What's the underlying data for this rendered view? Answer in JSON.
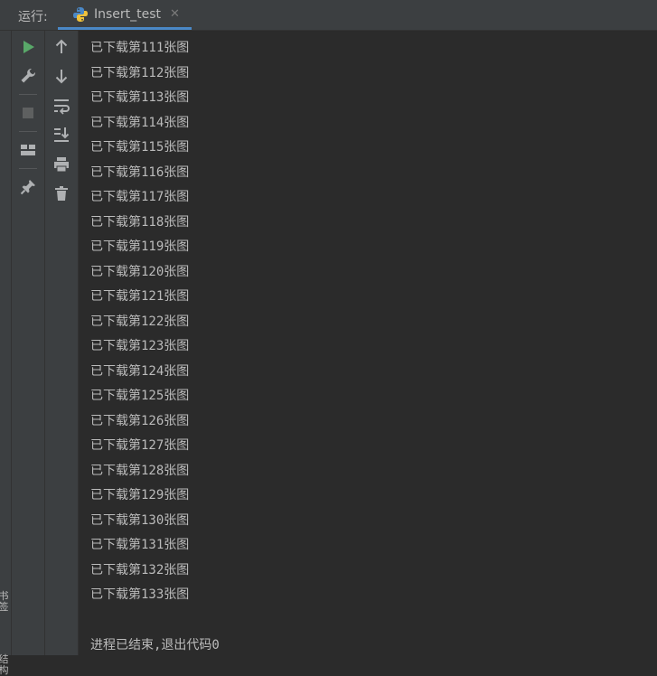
{
  "header": {
    "run_label": "运行:",
    "tab_label": "Insert_test",
    "tab_icon": "python-icon"
  },
  "left_strip": {
    "label1": "书签",
    "label2": "结构"
  },
  "toolbar1": {
    "buttons": [
      "run-icon",
      "wrench-icon",
      "stop-icon",
      "layout-icon",
      "pin-icon"
    ]
  },
  "toolbar2": {
    "buttons": [
      "up-arrow-icon",
      "down-arrow-icon",
      "soft-wrap-icon",
      "scroll-to-end-icon",
      "print-icon",
      "trash-icon"
    ]
  },
  "console": {
    "lines": [
      "已下载第111张图",
      "已下载第112张图",
      "已下载第113张图",
      "已下载第114张图",
      "已下载第115张图",
      "已下载第116张图",
      "已下载第117张图",
      "已下载第118张图",
      "已下载第119张图",
      "已下载第120张图",
      "已下载第121张图",
      "已下载第122张图",
      "已下载第123张图",
      "已下载第124张图",
      "已下载第125张图",
      "已下载第126张图",
      "已下载第127张图",
      "已下载第128张图",
      "已下载第129张图",
      "已下载第130张图",
      "已下载第131张图",
      "已下载第132张图",
      "已下载第133张图"
    ],
    "exit_message": "进程已结束,退出代码0"
  },
  "colors": {
    "background": "#2b2b2b",
    "panel": "#3c3f41",
    "text": "#bbbbbb",
    "run_green": "#59a869",
    "tab_underline": "#4a88c7"
  }
}
